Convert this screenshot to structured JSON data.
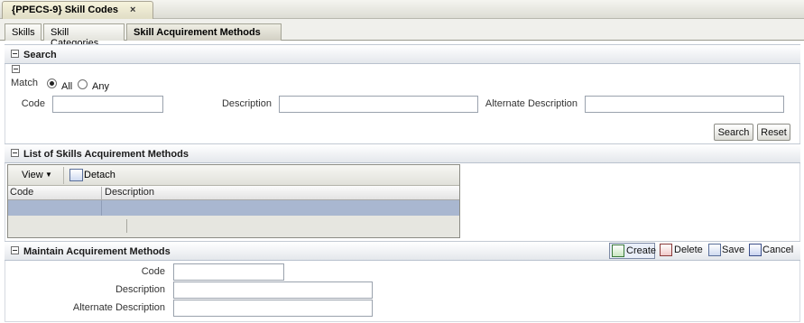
{
  "window_tab": {
    "title": "{PPECS-9} Skill Codes",
    "close": "×"
  },
  "tabs": [
    {
      "label": "Skills"
    },
    {
      "label": "Skill Categories"
    },
    {
      "label": "Skill Acquirement Methods"
    }
  ],
  "search": {
    "title": "Search",
    "match_label": "Match",
    "match_all": "All",
    "match_any": "Any",
    "match_selected": "All",
    "code_label": "Code",
    "code_value": "",
    "description_label": "Description",
    "description_value": "",
    "alt_description_label": "Alternate Description",
    "alt_description_value": "",
    "search_button": "Search",
    "reset_button": "Reset"
  },
  "list": {
    "title": "List of Skills Acquirement Methods",
    "view_menu": "View",
    "detach": "Detach",
    "columns": [
      "Code",
      "Description"
    ],
    "rows": [
      {
        "code": "",
        "description": ""
      }
    ]
  },
  "maintain": {
    "title": "Maintain Acquirement Methods",
    "actions": {
      "create": "Create",
      "delete": "Delete",
      "save": "Save",
      "cancel": "Cancel"
    },
    "code_label": "Code",
    "code_value": "",
    "description_label": "Description",
    "description_value": "",
    "alt_description_label": "Alternate Description",
    "alt_description_value": ""
  },
  "colors": {
    "panel_header": "#e4e7ec",
    "selected_row": "#a9b7d0",
    "active_tab": "#d2d0c4"
  }
}
